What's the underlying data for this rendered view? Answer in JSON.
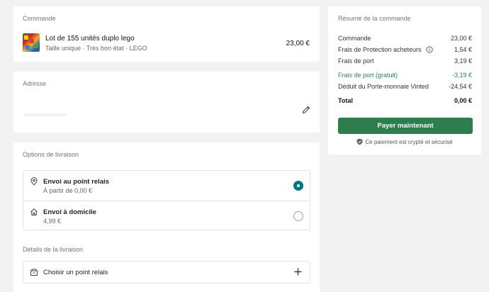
{
  "order": {
    "title": "Commande",
    "item_title": "Lot de 155 unités duplo lego",
    "item_sub": "Taille unique · Très bon état · LEGO",
    "item_price": "23,00 €"
  },
  "address": {
    "title": "Adresse"
  },
  "delivery": {
    "title": "Options de livraison",
    "options": [
      {
        "label": "Envoi au point relais",
        "sub": "À partir de 0,00 €",
        "selected": true
      },
      {
        "label": "Envoi à domicile",
        "sub": "4,99 €",
        "selected": false
      }
    ],
    "details_title": "Détails de la livraison",
    "pick_label": "Choisir un point relais"
  },
  "summary": {
    "title": "Résumé de la commande",
    "rows": [
      {
        "label": "Commande",
        "value": "23,00 €"
      },
      {
        "label": "Frais de Protection acheteurs",
        "value": "1,54 €"
      },
      {
        "label": "Frais de port",
        "value": "3,19 €"
      },
      {
        "label": "Frais de port (gratuit)",
        "value": "-3,19 €"
      },
      {
        "label": "Déduit du Porte-monnaie Vinted",
        "value": "-24,54 €"
      },
      {
        "label": "Total",
        "value": "0,00 €"
      }
    ],
    "pay_label": "Payer maintenant",
    "secure_text": "Ce paiement est crypté et sécurisé"
  },
  "colors": {
    "brand_green": "#2e7d4f",
    "radio_teal": "#007782",
    "discount_green": "#2e7d62"
  }
}
